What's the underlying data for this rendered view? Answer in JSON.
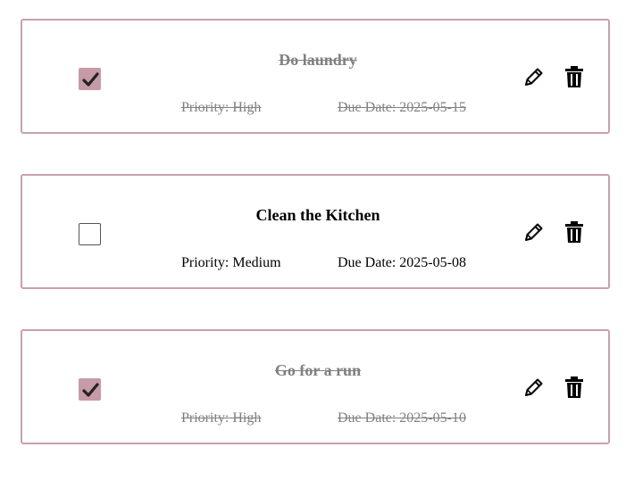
{
  "tasks": [
    {
      "title": "Do laundry",
      "priority": "Priority: High",
      "due": "Due Date: 2025-05-15",
      "completed": true
    },
    {
      "title": "Clean the Kitchen",
      "priority": "Priority: Medium",
      "due": "Due Date: 2025-05-08",
      "completed": false
    },
    {
      "title": "Go for a run",
      "priority": "Priority: High",
      "due": "Due Date: 2025-05-10",
      "completed": true
    }
  ],
  "icons": {
    "edit": "pencil-icon",
    "delete": "trash-icon",
    "check": "checkmark-icon"
  },
  "colors": {
    "card_border": "#c9a0b0",
    "checkbox_checked": "#c69aa6",
    "completed_text": "#808080"
  }
}
